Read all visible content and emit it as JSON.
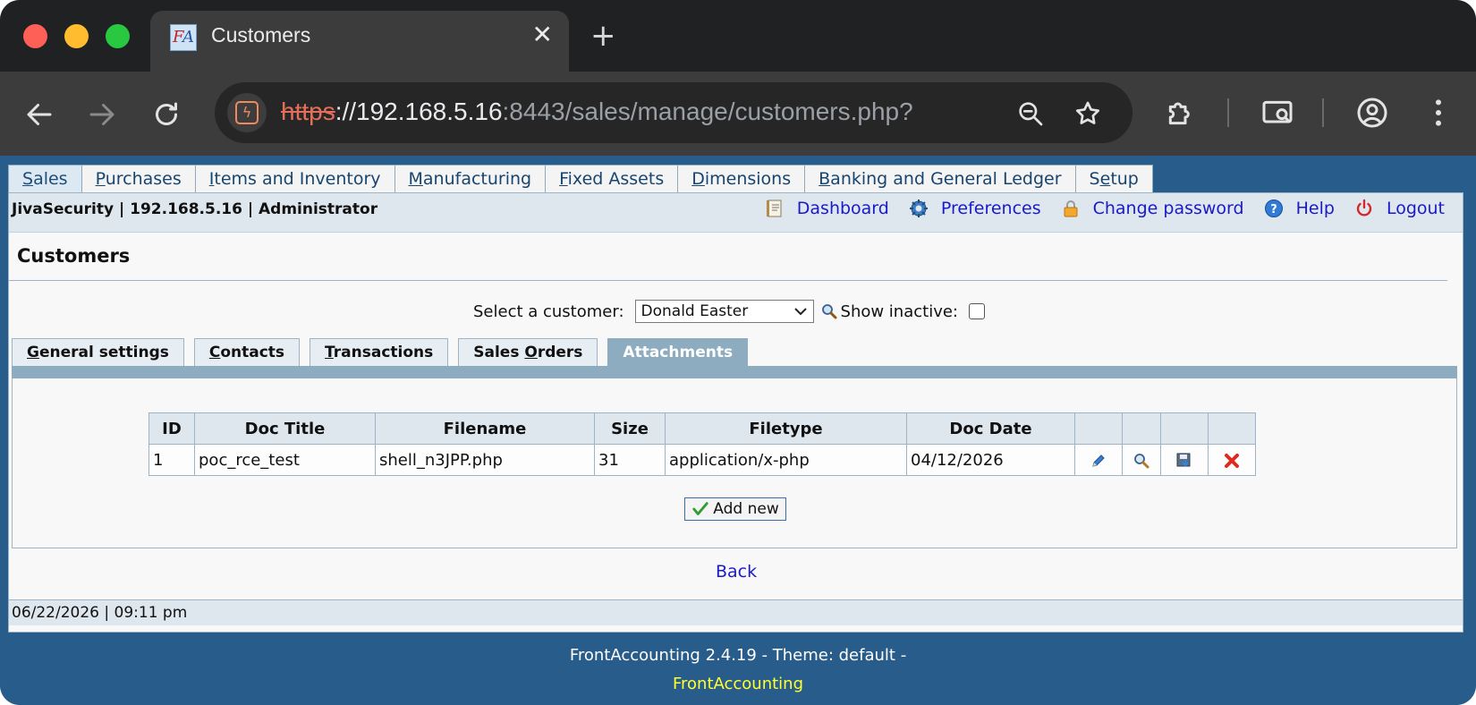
{
  "browser": {
    "tab_title": "Customers",
    "url_scheme": "https",
    "url_host": "://192.168.5.16",
    "url_rest": ":8443/sales/manage/customers.php?"
  },
  "menu": {
    "tabs": [
      {
        "pre": "",
        "u": "S",
        "post": "ales"
      },
      {
        "pre": "",
        "u": "P",
        "post": "urchases"
      },
      {
        "pre": "",
        "u": "I",
        "post": "tems and Inventory"
      },
      {
        "pre": "",
        "u": "M",
        "post": "anufacturing"
      },
      {
        "pre": "",
        "u": "F",
        "post": "ixed Assets"
      },
      {
        "pre": "",
        "u": "D",
        "post": "imensions"
      },
      {
        "pre": "",
        "u": "B",
        "post": "anking and General Ledger"
      },
      {
        "pre": "S",
        "u": "e",
        "post": "tup"
      }
    ]
  },
  "header": {
    "user_info": "JivaSecurity | 192.168.5.16 | Administrator",
    "dashboard": "Dashboard",
    "preferences": "Preferences",
    "change_password": "Change password",
    "help": "Help",
    "logout": "Logout"
  },
  "page": {
    "title": "Customers",
    "select_label": "Select a customer:",
    "selected_customer": "Donald Easter",
    "show_inactive_label": "Show inactive:"
  },
  "subtabs": [
    {
      "pre": "",
      "u": "G",
      "post": "eneral settings"
    },
    {
      "pre": "",
      "u": "C",
      "post": "ontacts"
    },
    {
      "pre": "",
      "u": "T",
      "post": "ransactions"
    },
    {
      "pre": "Sales ",
      "u": "O",
      "post": "rders"
    },
    {
      "pre": "Attachments",
      "u": "",
      "post": ""
    }
  ],
  "table": {
    "headers": [
      "ID",
      "Doc Title",
      "Filename",
      "Size",
      "Filetype",
      "Doc Date"
    ],
    "rows": [
      {
        "id": "1",
        "title": "poc_rce_test",
        "filename": "shell_n3JPP.php",
        "size": "31",
        "filetype": "application/x-php",
        "date": "04/12/2026"
      }
    ]
  },
  "add_new_label": "Add new",
  "back_label": "Back",
  "status": {
    "datetime": "06/22/2026 | 09:11 pm"
  },
  "footer": {
    "version": "FrontAccounting 2.4.19 - Theme: default -",
    "link": "FrontAccounting"
  },
  "colors": {
    "brand_blue": "#285c8a",
    "link": "#1a1acb",
    "footer_link": "#ffff33"
  }
}
